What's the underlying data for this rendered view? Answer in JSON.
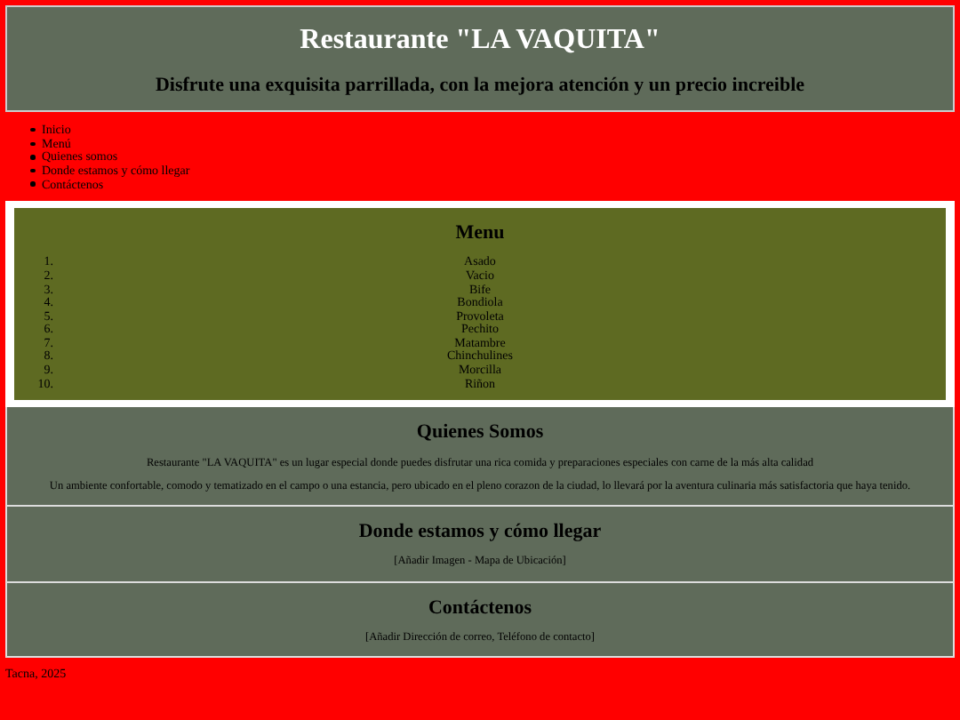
{
  "header": {
    "title": "Restaurante \"LA VAQUITA\"",
    "subtitle": "Disfrute una exquisita parrillada, con la mejora atención y un precio increible"
  },
  "nav": [
    {
      "label": "Inicio"
    },
    {
      "label": "Menú"
    },
    {
      "label": "Quienes somos"
    },
    {
      "label": "Donde estamos y cómo llegar"
    },
    {
      "label": "Contáctenos"
    }
  ],
  "menu": {
    "title": "Menu",
    "items": [
      {
        "number": "1.",
        "name": "Asado"
      },
      {
        "number": "2.",
        "name": "Vacio"
      },
      {
        "number": "3.",
        "name": "Bife"
      },
      {
        "number": "4.",
        "name": "Bondiola"
      },
      {
        "number": "5.",
        "name": "Provoleta"
      },
      {
        "number": "6.",
        "name": "Pechito"
      },
      {
        "number": "7.",
        "name": "Matambre"
      },
      {
        "number": "8.",
        "name": "Chinchulines"
      },
      {
        "number": "9.",
        "name": "Morcilla"
      },
      {
        "number": "10.",
        "name": "Riñon"
      }
    ]
  },
  "sections": [
    {
      "title": "Quienes Somos",
      "paragraphs": [
        "Restaurante \"LA VAQUITA\" es un lugar especial donde puedes disfrutar una rica comida y preparaciones especiales con carne de la más alta calidad",
        "Un ambiente confortable, comodo y tematizado en el campo o una estancia, pero ubicado en el pleno corazon de la ciudad, lo llevará por la aventura culinaria más satisfactoria que haya tenido."
      ]
    },
    {
      "title": "Donde estamos y cómo llegar",
      "paragraphs": [
        "[Añadir Imagen - Mapa de Ubicación]"
      ]
    },
    {
      "title": "Contáctenos",
      "paragraphs": [
        "[Añadir Dirección de correo, Teléfono de contacto]"
      ]
    }
  ],
  "footer": "Tacna, 2025"
}
